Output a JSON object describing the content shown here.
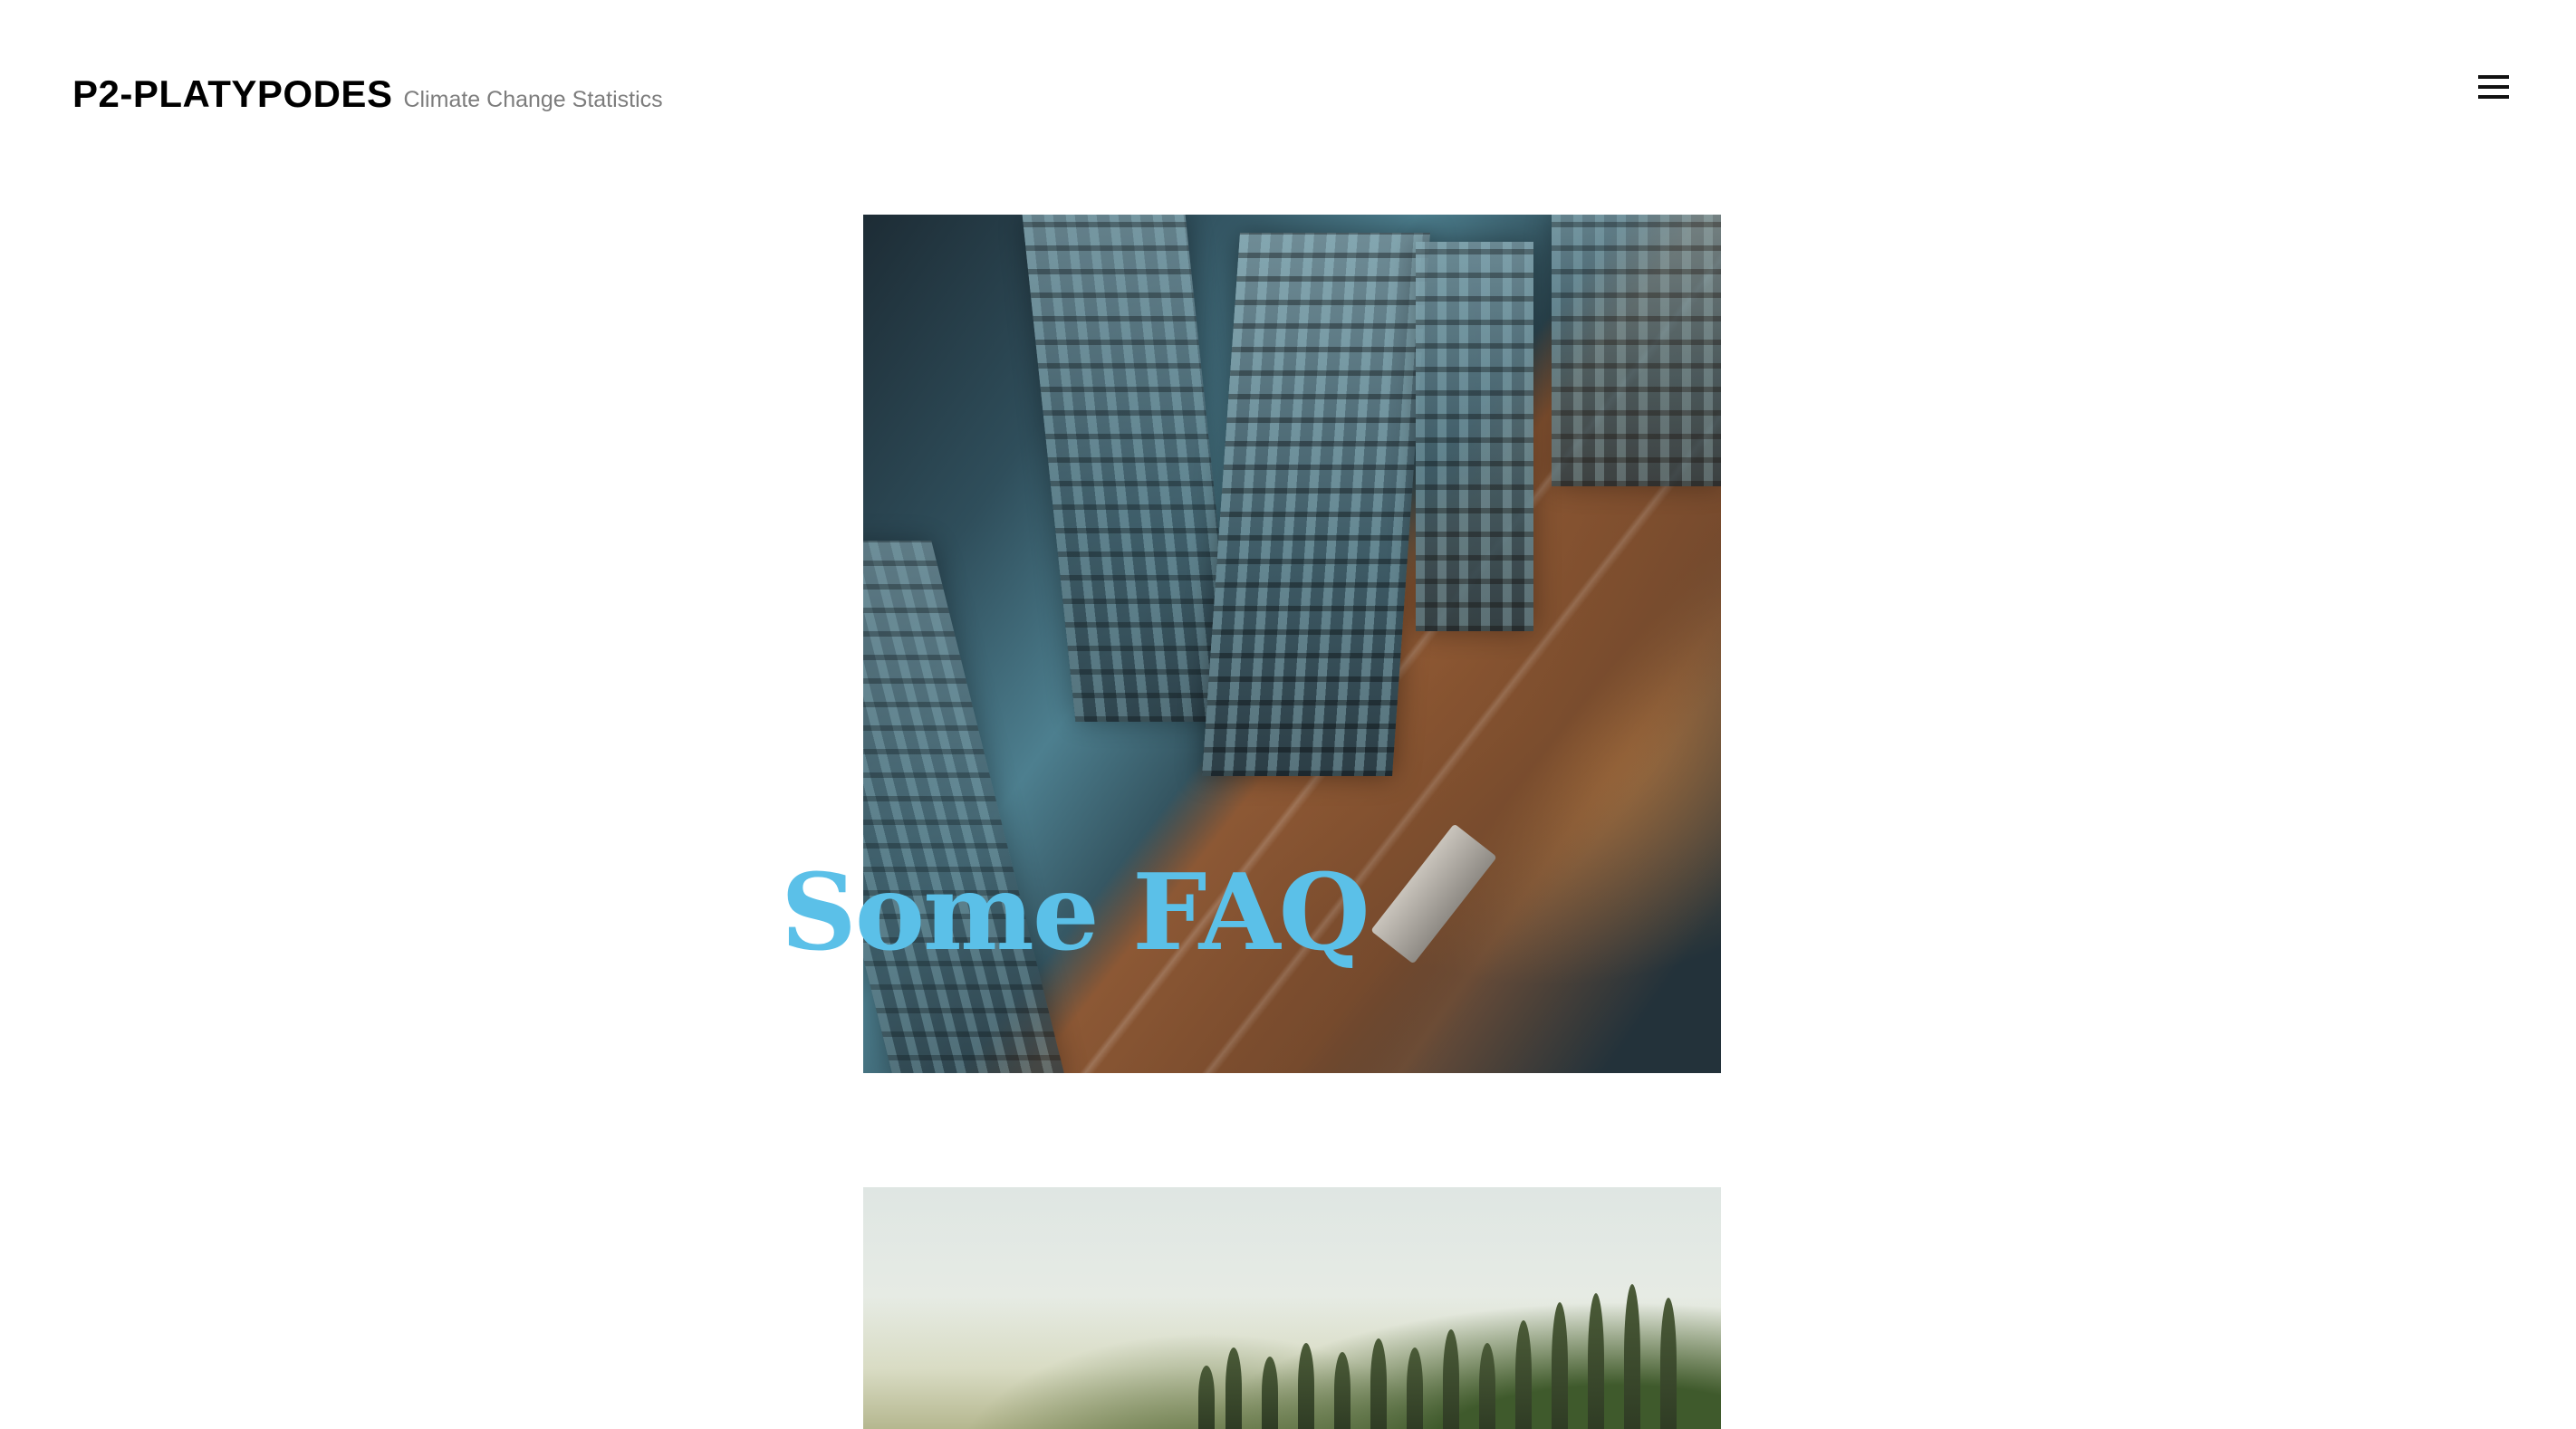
{
  "header": {
    "site_title": "P2-PLATYPODES",
    "tagline": "Climate Change Statistics",
    "menu_icon": "hamburger-menu-icon"
  },
  "posts": [
    {
      "title": "Some FAQ",
      "image": "aerial-city-night-photo",
      "title_color": "#5bc0e8"
    },
    {
      "title": "",
      "image": "trees-landscape-photo"
    }
  ],
  "colors": {
    "background": "#ffffff",
    "site_title": "#000000",
    "tagline": "#7d7d7d",
    "accent": "#5bc0e8"
  }
}
